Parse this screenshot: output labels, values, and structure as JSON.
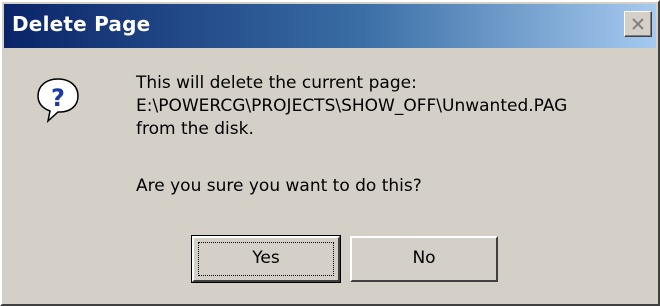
{
  "window": {
    "title": "Delete Page"
  },
  "message": {
    "line1": "This will delete the current page:",
    "line2": "E:\\POWERCG\\PROJECTS\\SHOW_OFF\\Unwanted.PAG",
    "line3": "from the disk.",
    "question": "Are you sure you want to do this?"
  },
  "buttons": {
    "yes_label": "Yes",
    "no_label": "No"
  },
  "icons": {
    "message_icon": "question-icon",
    "close_icon": "close-icon"
  },
  "colors": {
    "dialog_face": "#d4d0c8",
    "title_start": "#0a246a",
    "title_end": "#a6caf0",
    "icon_blue": "#1a3aa8"
  }
}
